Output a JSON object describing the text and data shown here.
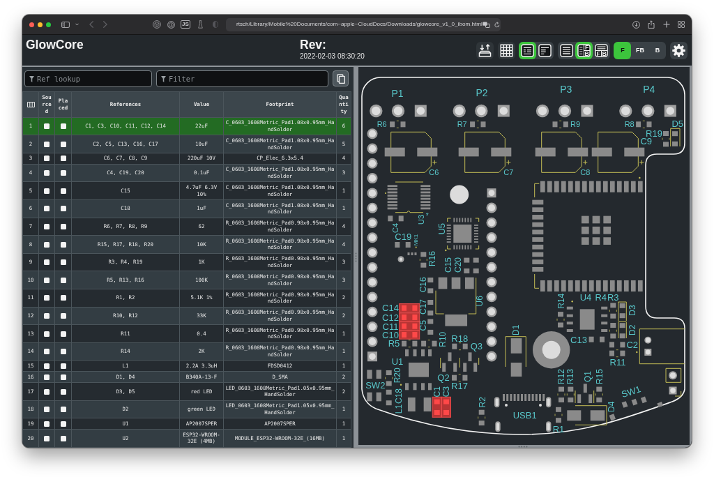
{
  "browser": {
    "navigation": [
      {
        "kind": "back",
        "disabled": true
      },
      {
        "kind": "forward",
        "disabled": true
      }
    ],
    "extension_badge": "JS",
    "url": "rtsch/Library/Mobile%20Documents/com~apple~CloudDocs/Downloads/glowcore_v1_0_ibom.html"
  },
  "header": {
    "title": "GlowCore",
    "revision_label": "Rev:",
    "revision_date": "2022-02-03 08:30:20",
    "button_groups": [
      {
        "buttons": [
          {
            "kind": "tray",
            "selected": false
          }
        ]
      },
      {
        "buttons": [
          {
            "kind": "grid",
            "selected": false
          }
        ]
      },
      {
        "buttons": [
          {
            "kind": "grouped",
            "selected": true
          },
          {
            "kind": "ungrouped",
            "selected": false
          }
        ]
      },
      {
        "buttons": [
          {
            "kind": "bom-only",
            "selected": false
          },
          {
            "kind": "left-right",
            "selected": true,
            "marks": [
              "F",
              "B"
            ]
          },
          {
            "kind": "top-bottom",
            "selected": false,
            "marks": [
              "F",
              "B"
            ]
          }
        ]
      },
      {
        "buttons": [
          {
            "kind": "text",
            "label": "F",
            "selected": true
          },
          {
            "kind": "text",
            "label": "FB",
            "selected": false
          },
          {
            "kind": "text",
            "label": "B",
            "selected": false
          }
        ]
      },
      {
        "buttons": [
          {
            "kind": "settings"
          }
        ]
      }
    ]
  },
  "bom": {
    "search": [
      {
        "placeholder": "Ref lookup"
      },
      {
        "placeholder": "Filter"
      }
    ],
    "columns": [
      "Sourced",
      "Placed",
      "References",
      "Value",
      "Footprint",
      "Quantity"
    ],
    "rows": [
      {
        "number": "1",
        "sourced_checked": false,
        "placed_checked": false,
        "references": "C1, C3, C10, C11, C12, C14",
        "value": "22uF",
        "footprint": "C_0603_1608Metric_Pad1.08x0.95mm_HandSolder",
        "quantity": "6",
        "selected": true
      },
      {
        "number": "2",
        "sourced_checked": false,
        "placed_checked": false,
        "references": "C2, C5, C13, C16, C17",
        "value": "10uF",
        "footprint": "C_0603_1608Metric_Pad1.08x0.95mm_HandSolder",
        "quantity": "5",
        "selected": false
      },
      {
        "number": "3",
        "sourced_checked": false,
        "placed_checked": false,
        "references": "C6, C7, C8, C9",
        "value": "220uF 10V",
        "footprint": "CP_Elec_6.3x5.4",
        "quantity": "4",
        "selected": false
      },
      {
        "number": "4",
        "sourced_checked": false,
        "placed_checked": false,
        "references": "C4, C19, C20",
        "value": "0.1uF",
        "footprint": "C_0603_1608Metric_Pad1.08x0.95mm_HandSolder",
        "quantity": "3",
        "selected": false
      },
      {
        "number": "5",
        "sourced_checked": false,
        "placed_checked": false,
        "references": "C15",
        "value": "4.7uF 6.3V 10%",
        "footprint": "C_0603_1608Metric_Pad1.08x0.95mm_HandSolder",
        "quantity": "1",
        "selected": false
      },
      {
        "number": "6",
        "sourced_checked": false,
        "placed_checked": false,
        "references": "C18",
        "value": "1uF",
        "footprint": "C_0603_1608Metric_Pad1.08x0.95mm_HandSolder",
        "quantity": "1",
        "selected": false
      },
      {
        "number": "7",
        "sourced_checked": false,
        "placed_checked": false,
        "references": "R6, R7, R8, R9",
        "value": "62",
        "footprint": "R_0603_1608Metric_Pad0.98x0.95mm_HandSolder",
        "quantity": "4",
        "selected": false
      },
      {
        "number": "8",
        "sourced_checked": false,
        "placed_checked": false,
        "references": "R15, R17, R18, R20",
        "value": "10K",
        "footprint": "R_0603_1608Metric_Pad0.98x0.95mm_HandSolder",
        "quantity": "4",
        "selected": false
      },
      {
        "number": "9",
        "sourced_checked": false,
        "placed_checked": false,
        "references": "R3, R4, R19",
        "value": "1K",
        "footprint": "R_0603_1608Metric_Pad0.98x0.95mm_HandSolder",
        "quantity": "3",
        "selected": false
      },
      {
        "number": "10",
        "sourced_checked": false,
        "placed_checked": false,
        "references": "R5, R13, R16",
        "value": "100K",
        "footprint": "R_0603_1608Metric_Pad0.98x0.95mm_HandSolder",
        "quantity": "3",
        "selected": false
      },
      {
        "number": "11",
        "sourced_checked": false,
        "placed_checked": false,
        "references": "R1, R2",
        "value": "5.1K 1%",
        "footprint": "R_0603_1608Metric_Pad0.98x0.95mm_HandSolder",
        "quantity": "2",
        "selected": false
      },
      {
        "number": "12",
        "sourced_checked": false,
        "placed_checked": false,
        "references": "R10, R12",
        "value": "33K",
        "footprint": "R_0603_1608Metric_Pad0.98x0.95mm_HandSolder",
        "quantity": "2",
        "selected": false
      },
      {
        "number": "13",
        "sourced_checked": false,
        "placed_checked": false,
        "references": "R11",
        "value": "0.4",
        "footprint": "R_0603_1608Metric_Pad0.98x0.95mm_HandSolder",
        "quantity": "1",
        "selected": false
      },
      {
        "number": "14",
        "sourced_checked": false,
        "placed_checked": false,
        "references": "R14",
        "value": "2K",
        "footprint": "R_0603_1608Metric_Pad0.98x0.95mm_HandSolder",
        "quantity": "1",
        "selected": false
      },
      {
        "number": "15",
        "sourced_checked": false,
        "placed_checked": false,
        "references": "L1",
        "value": "2.2A 3.3uH",
        "footprint": "FDSD0412",
        "quantity": "1",
        "selected": false
      },
      {
        "number": "16",
        "sourced_checked": false,
        "placed_checked": false,
        "references": "D1, D4",
        "value": "B340A-13-F",
        "footprint": "D_SMA",
        "quantity": "2",
        "selected": false
      },
      {
        "number": "17",
        "sourced_checked": false,
        "placed_checked": false,
        "references": "D3, D5",
        "value": "red LED",
        "footprint": "LED_0603_1608Metric_Pad1.05x0.95mm_HandSolder",
        "quantity": "2",
        "selected": false
      },
      {
        "number": "18",
        "sourced_checked": false,
        "placed_checked": false,
        "references": "D2",
        "value": "green LED",
        "footprint": "LED_0603_1608Metric_Pad1.05x0.95mm_HandSolder",
        "quantity": "1",
        "selected": false
      },
      {
        "number": "19",
        "sourced_checked": false,
        "placed_checked": false,
        "references": "U1",
        "value": "AP2007SPER",
        "footprint": "AP2007SPER",
        "quantity": "1",
        "selected": false
      },
      {
        "number": "20",
        "sourced_checked": false,
        "placed_checked": false,
        "references": "U2",
        "value": "ESP32-WROOM-32E (4MB)",
        "footprint": "MODULE_ESP32-WROOM-32E_(16MB)",
        "quantity": "1",
        "selected": false
      }
    ]
  },
  "board": {
    "labels": [
      "P1",
      "P2",
      "P3",
      "P4",
      "R6",
      "R7",
      "R9",
      "R8",
      "D5",
      "R19",
      "C9",
      "C6",
      "C7",
      "C8",
      "U3",
      "*",
      "C4",
      "U5",
      "C19",
      "MK1",
      "R16",
      "C15",
      "C20",
      "C16",
      "U6",
      "R14",
      "U4",
      "R4",
      "R3",
      "C14",
      "C17",
      "D3",
      "C12",
      "C11",
      "C5",
      "D1",
      "D2",
      "C10",
      "R10",
      "R18",
      "C13",
      "R5",
      "Q3",
      "C2",
      "U1",
      "R11",
      "R20",
      "Q2",
      "R12",
      "R13",
      "Q1",
      "R15",
      "SW2",
      "R17",
      "C18",
      "C1",
      "C3",
      "SW1",
      "L1",
      "R2",
      "D4",
      "USB1",
      "R1"
    ],
    "capacitor_footprints": [
      {
        "highlighted": true
      },
      {
        "highlighted": true
      },
      {
        "highlighted": true
      },
      {
        "highlighted": true
      },
      {
        "highlighted": true
      },
      {
        "highlighted": true
      },
      {
        "highlighted": false
      },
      {
        "highlighted": false
      },
      {
        "highlighted": false
      },
      {
        "highlighted": false
      },
      {
        "highlighted": false
      },
      {
        "highlighted": false
      },
      {
        "highlighted": false
      },
      {
        "highlighted": false
      },
      {
        "highlighted": false
      },
      {
        "highlighted": false
      }
    ]
  }
}
